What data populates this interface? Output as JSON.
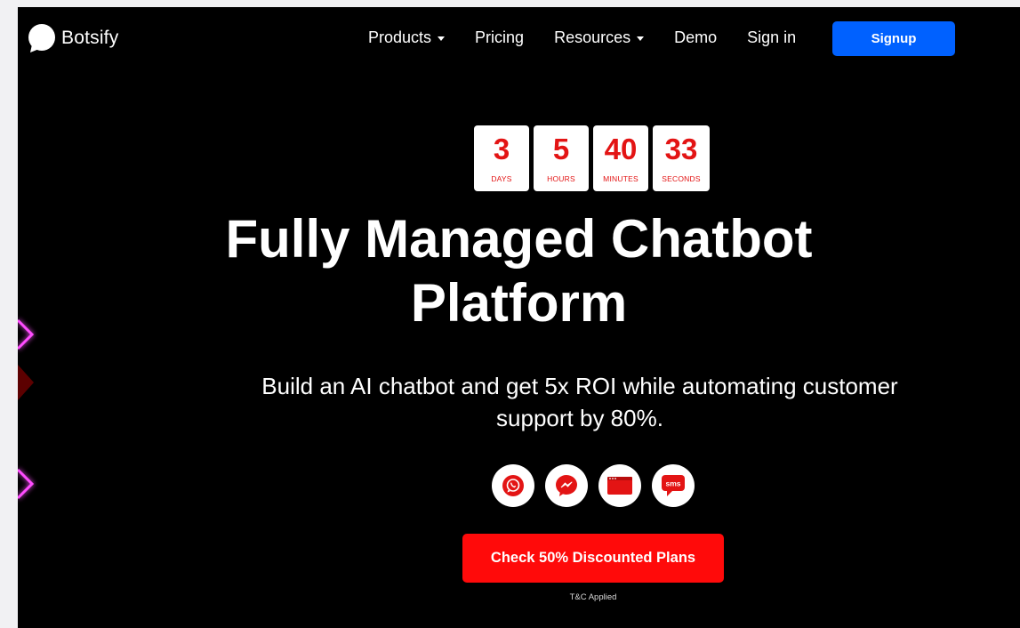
{
  "brand": {
    "name": "Botsify"
  },
  "nav": {
    "items": [
      {
        "label": "Products",
        "dropdown": true
      },
      {
        "label": "Pricing",
        "dropdown": false
      },
      {
        "label": "Resources",
        "dropdown": true
      },
      {
        "label": "Demo",
        "dropdown": false
      },
      {
        "label": "Sign in",
        "dropdown": false
      }
    ],
    "signup_label": "Signup"
  },
  "countdown": [
    {
      "value": "3",
      "label": "DAYS"
    },
    {
      "value": "5",
      "label": "HOURS"
    },
    {
      "value": "40",
      "label": "MINUTES"
    },
    {
      "value": "33",
      "label": "SECONDS"
    }
  ],
  "hero": {
    "title_line1": "Fully Managed Chatbot",
    "title_line2": "Platform",
    "subtitle_line1": "Build an AI chatbot and get 5x ROI while automating customer",
    "subtitle_line2": "support by 80%.",
    "cta_label": "Check 50% Discounted Plans",
    "terms": "T&C Applied"
  },
  "channels": [
    {
      "name": "whatsapp-icon"
    },
    {
      "name": "messenger-icon"
    },
    {
      "name": "web-widget-icon"
    },
    {
      "name": "sms-icon",
      "text": "sms"
    }
  ],
  "colors": {
    "accent": "#e31414",
    "signup": "#0061ff",
    "cta": "#ff0a0a",
    "background": "#000000"
  }
}
